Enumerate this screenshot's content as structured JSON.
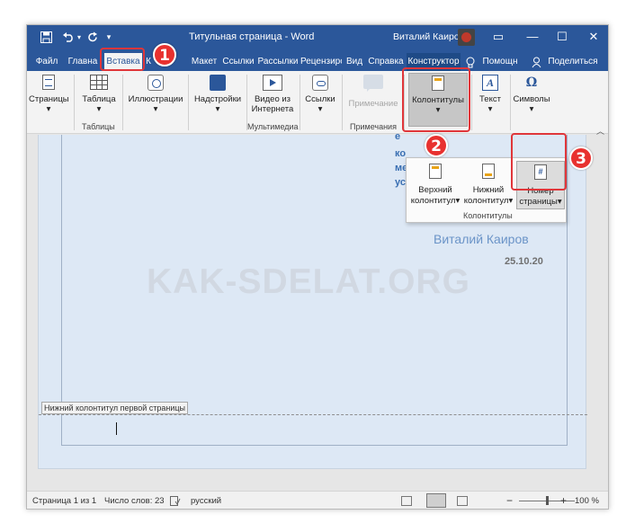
{
  "titlebar": {
    "document_title": "Титульная страница  -  Word",
    "user_name": "Виталий Каиров",
    "quick_access": [
      "save-icon",
      "undo-icon",
      "redo-icon",
      "customize-icon"
    ],
    "window_controls": {
      "restore": "▭",
      "minimize": "—",
      "maximize": "☐",
      "close": "✕"
    }
  },
  "tabs": {
    "items": [
      "Файл",
      "Главна",
      "Вставка",
      "К",
      "Макет",
      "Ссылки",
      "Рассылки",
      "Рецензиро",
      "Вид",
      "Справка",
      "Конструктор",
      "Помощн",
      "Поделиться"
    ],
    "active": "Вставка"
  },
  "ribbon": {
    "pages": "Страницы",
    "table": "Таблица",
    "illustrations": "Иллюстрации",
    "addins": "Надстройки",
    "video_line1": "Видео из",
    "video_line2": "Интернета",
    "links": "Ссылки",
    "comment": "Примечание",
    "headers_footers": "Колонтитулы",
    "text": "Текст",
    "symbols": "Символы",
    "group_tables": "Таблицы",
    "group_media": "Мультимедиа",
    "group_comments": "Примечания",
    "dropdown_arrow": "▾"
  },
  "document": {
    "partial_lines": [
      "е",
      "ко",
      "ме",
      "ус"
    ],
    "author": "Виталий Каиров",
    "date": "25.10.20",
    "watermark": "KAK-SDELAT.ORG",
    "footer_label": "Нижний колонтитул первой страницы"
  },
  "dropdown": {
    "header_line1": "Верхний",
    "header_line2": "колонтитул",
    "footer_line1": "Нижний",
    "footer_line2": "колонтитул",
    "pagenum_line1": "Номер",
    "pagenum_line2": "страницы",
    "group_label": "Колонтитулы",
    "pagenum_icon_text": "#"
  },
  "statusbar": {
    "page": "Страница 1 из 1",
    "words": "Число слов: 23",
    "language": "русский",
    "zoom": "100 %",
    "zoom_minus": "−",
    "zoom_plus": "+"
  },
  "annotations": {
    "step1": "1",
    "step2": "2",
    "step3": "3"
  },
  "colors": {
    "accent": "#2b579a",
    "highlight": "#e0363a"
  }
}
